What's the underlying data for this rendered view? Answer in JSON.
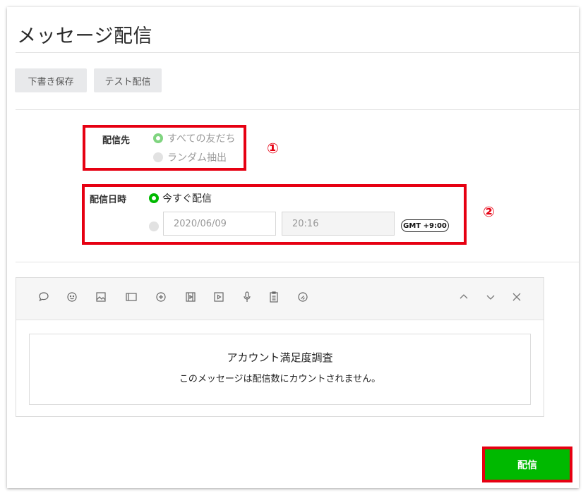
{
  "header": {
    "title": "メッセージ配信"
  },
  "toolbar": {
    "draft_label": "下書き保存",
    "test_label": "テスト配信"
  },
  "recipients": {
    "label": "配信先",
    "options": [
      {
        "label": "すべての友だち",
        "selected": true
      },
      {
        "label": "ランダム抽出",
        "selected": false
      }
    ],
    "marker": "①"
  },
  "schedule": {
    "label": "配信日時",
    "now_label": "今すぐ配信",
    "date_placeholder": "2020/06/09",
    "time_placeholder": "20:16",
    "timezone": "GMT +9:00",
    "marker": "②"
  },
  "editor": {
    "icons": [
      "speech-bubble-icon",
      "emoji-icon",
      "image-icon",
      "card-icon",
      "rich-message-icon",
      "video-icon",
      "play-icon",
      "microphone-icon",
      "survey-icon",
      "sticker-icon"
    ],
    "message_title": "アカウント満足度調査",
    "message_note": "このメッセージは配信数にカウントされません。"
  },
  "footer": {
    "send_label": "配信"
  },
  "colors": {
    "accent": "#00b900",
    "highlight": "#e60012"
  }
}
